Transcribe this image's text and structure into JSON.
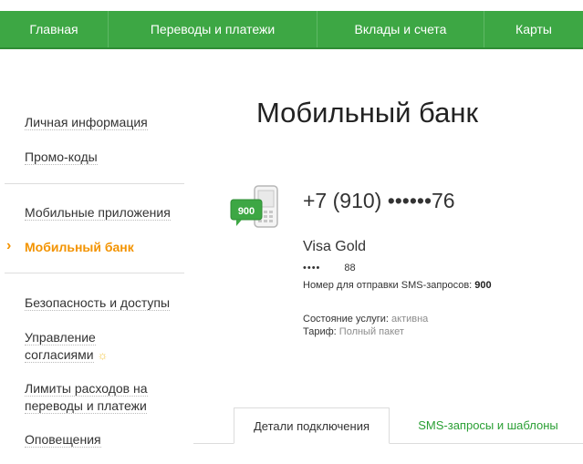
{
  "nav": {
    "items": [
      {
        "label": "Главная"
      },
      {
        "label": "Переводы и платежи"
      },
      {
        "label": "Вклады и счета"
      },
      {
        "label": "Карты"
      }
    ]
  },
  "sidebar": {
    "items": [
      {
        "label": "Личная информация"
      },
      {
        "label": "Промо-коды"
      },
      {
        "label": "Мобильные приложения"
      },
      {
        "label": "Мобильный банк",
        "active": true
      },
      {
        "label": "Безопасность и доступы"
      },
      {
        "label": "Управление согласиями",
        "lines": [
          "Управление",
          "согласиями"
        ],
        "icon": "sun-icon"
      },
      {
        "label": "Лимиты расходов на переводы и платежи",
        "lines": [
          "Лимиты расходов на",
          "переводы и платежи"
        ]
      },
      {
        "label": "Оповещения"
      }
    ],
    "active_marker": "›"
  },
  "main": {
    "title": "Мобильный банк",
    "phone_badge": "900",
    "phone_number": "+7 (910) ••••••76",
    "card_name": "Visa Gold",
    "card_mask": "••••",
    "card_last": "88",
    "sms_label": "Номер для отправки SMS-запросов:",
    "sms_number": "900",
    "status_label": "Состояние услуги:",
    "status_value": "активна",
    "tariff_label": "Тариф:",
    "tariff_value": "Полный пакет"
  },
  "tabs": [
    {
      "label": "Детали подключения",
      "active": true
    },
    {
      "label": "SMS-запросы и шаблоны",
      "active": false
    }
  ],
  "colors": {
    "brand_green": "#3da744",
    "accent_orange": "#f39300",
    "link_green": "#2a9f34",
    "muted_text": "#8c8c8c"
  }
}
